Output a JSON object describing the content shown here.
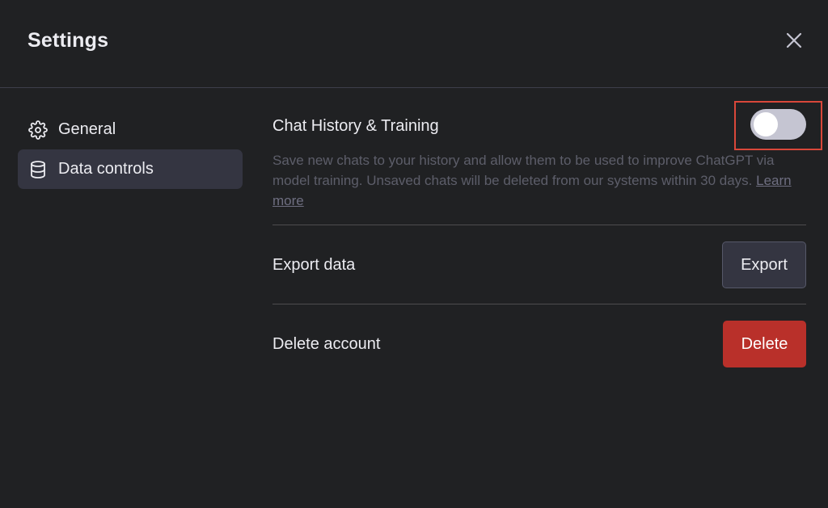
{
  "header": {
    "title": "Settings"
  },
  "sidebar": {
    "items": [
      {
        "label": "General",
        "icon": "gear-icon",
        "active": false
      },
      {
        "label": "Data controls",
        "icon": "database-icon",
        "active": true
      }
    ]
  },
  "chat_history": {
    "title": "Chat History & Training",
    "description": "Save new chats to your history and allow them to be used to improve ChatGPT via model training. Unsaved chats will be deleted from our systems within 30 days.",
    "learn_more": "Learn more",
    "toggle_on": false
  },
  "export_data": {
    "label": "Export data",
    "button": "Export"
  },
  "delete_account": {
    "label": "Delete account",
    "button": "Delete"
  },
  "colors": {
    "background": "#202123",
    "active_nav": "#343541",
    "delete_button": "#b9302a",
    "highlight_box": "#d9473a",
    "toggle_off": "#c5c5d2"
  }
}
